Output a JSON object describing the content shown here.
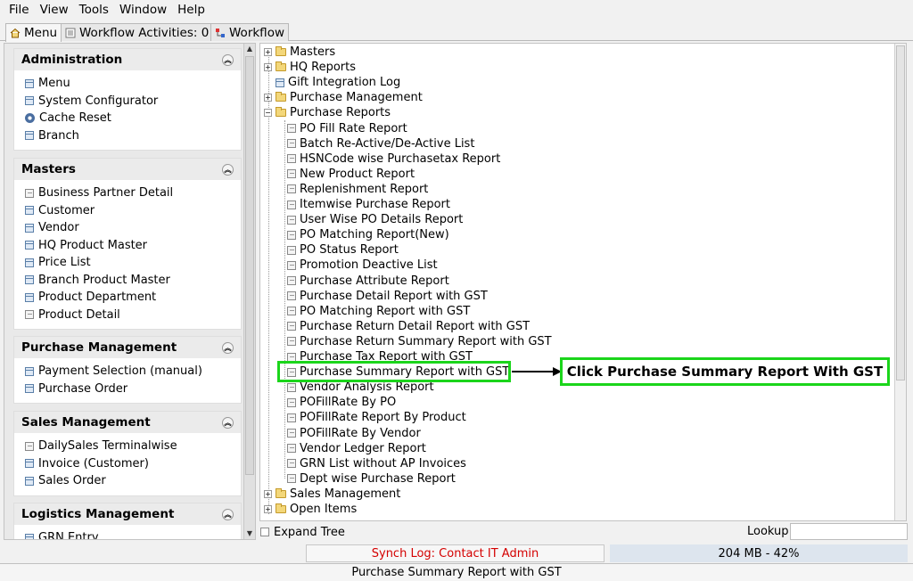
{
  "menubar": {
    "items": [
      "File",
      "View",
      "Tools",
      "Window",
      "Help"
    ]
  },
  "tabs": [
    {
      "label": "Menu",
      "active": true
    },
    {
      "label": "Workflow Activities: 0",
      "active": false
    },
    {
      "label": "Workflow",
      "active": false
    }
  ],
  "groups": [
    {
      "title": "Administration",
      "items": [
        {
          "label": "Menu",
          "icon": "window-icon"
        },
        {
          "label": "System Configurator",
          "icon": "window-icon"
        },
        {
          "label": "Cache Reset",
          "icon": "gear-icon"
        },
        {
          "label": "Branch",
          "icon": "window-icon"
        }
      ]
    },
    {
      "title": "Masters",
      "items": [
        {
          "label": "Business Partner Detail",
          "icon": "report-icon"
        },
        {
          "label": "Customer",
          "icon": "window-icon"
        },
        {
          "label": "Vendor",
          "icon": "window-icon"
        },
        {
          "label": "HQ Product Master",
          "icon": "window-icon"
        },
        {
          "label": "Price List",
          "icon": "window-icon"
        },
        {
          "label": "Branch Product Master",
          "icon": "window-icon"
        },
        {
          "label": "Product Department",
          "icon": "window-icon"
        },
        {
          "label": "Product Detail",
          "icon": "report-icon"
        }
      ]
    },
    {
      "title": "Purchase Management",
      "items": [
        {
          "label": "Payment Selection (manual)",
          "icon": "window-icon"
        },
        {
          "label": "Purchase Order",
          "icon": "window-icon"
        }
      ]
    },
    {
      "title": "Sales Management",
      "items": [
        {
          "label": "DailySales Terminalwise",
          "icon": "report-icon"
        },
        {
          "label": "Invoice (Customer)",
          "icon": "window-icon"
        },
        {
          "label": "Sales Order",
          "icon": "window-icon"
        }
      ]
    },
    {
      "title": "Logistics Management",
      "items": [
        {
          "label": "GRN Entry",
          "icon": "window-icon"
        }
      ]
    }
  ],
  "tree": {
    "top_nodes": [
      {
        "label": "Masters",
        "type": "folder",
        "expanded": false
      },
      {
        "label": "HQ Reports",
        "type": "folder",
        "expanded": false
      },
      {
        "label": "Gift Integration Log",
        "type": "window"
      },
      {
        "label": "Purchase Management",
        "type": "folder",
        "expanded": false
      },
      {
        "label": "Purchase Reports",
        "type": "folder",
        "expanded": true
      }
    ],
    "report_items": [
      "PO Fill Rate Report",
      "Batch Re-Active/De-Active List",
      "HSNCode wise Purchasetax Report",
      "New Product Report",
      "Replenishment Report",
      "Itemwise Purchase Report",
      "User Wise PO Details Report",
      "PO Matching Report(New)",
      "PO Status Report",
      "Promotion Deactive List",
      "Purchase Attribute Report",
      "Purchase Detail Report with GST",
      "PO Matching Report with GST",
      "Purchase Return Detail Report with GST",
      "Purchase Return Summary Report with GST",
      "Purchase Tax Report with GST",
      "Purchase Summary Report with GST",
      "Vendor Analysis Report",
      "POFillRate By PO",
      "POFillRate Report By Product",
      "POFillRate By Vendor",
      "Vendor Ledger Report",
      "GRN List without AP Invoices",
      "Dept wise Purchase Report"
    ],
    "bottom_nodes": [
      {
        "label": "Sales Management",
        "type": "folder",
        "expanded": false
      },
      {
        "label": "Open Items",
        "type": "folder",
        "expanded": false
      }
    ],
    "highlighted": "Purchase Summary Report with GST"
  },
  "annotation": {
    "callout_text": "Click Purchase Summary Report With GST",
    "color": "#1bd51b"
  },
  "bottom": {
    "expand_tree_label": "Expand Tree",
    "lookup_label": "Lookup",
    "lookup_value": ""
  },
  "status": {
    "synch_log": "Synch Log: Contact IT Admin",
    "memory": "204 MB - 42%",
    "message": "Purchase Summary Report with GST"
  }
}
